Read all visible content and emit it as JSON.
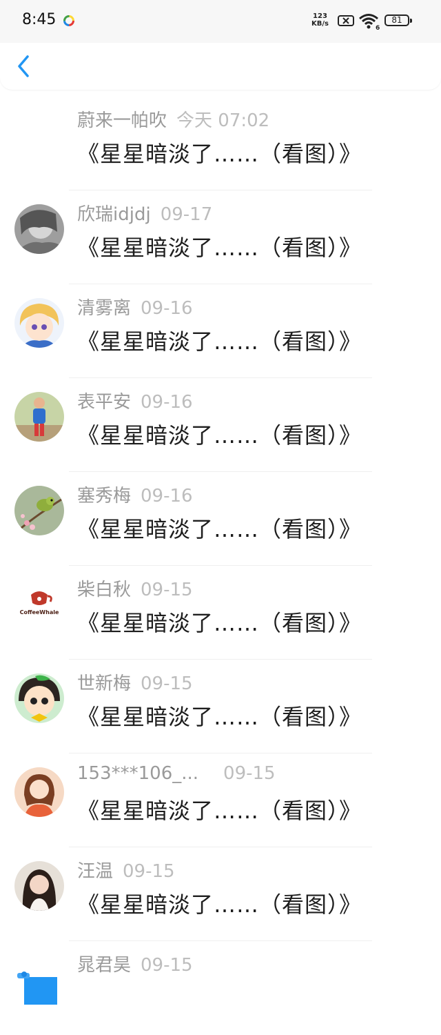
{
  "status_bar": {
    "time": "8:45",
    "net_speed_value": "123",
    "net_speed_unit": "KB/s",
    "battery": "81"
  },
  "header": {
    "back_icon": "chevron-left"
  },
  "colors": {
    "accent": "#2196f3",
    "name": "#9a9a9a",
    "date": "#bdbdbd",
    "content": "#1e1e1e"
  },
  "comments": [
    {
      "name": "蔚来一帕吹",
      "date": "今天 07:02",
      "text": "《星星暗淡了……（看图）》",
      "avatar": "none"
    },
    {
      "name": "欣瑞idjdj",
      "date": "09-17",
      "text": "《星星暗淡了……（看图）》",
      "avatar": "gray-photo"
    },
    {
      "name": "清雾离",
      "date": "09-16",
      "text": "《星星暗淡了……（看图）》",
      "avatar": "cartoon-girl"
    },
    {
      "name": "表平安",
      "date": "09-16",
      "text": "《星星暗淡了……（看图）》",
      "avatar": "kid-photo"
    },
    {
      "name": "塞秀梅",
      "date": "09-16",
      "text": "《星星暗淡了……（看图）》",
      "avatar": "bird-photo"
    },
    {
      "name": "柴白秋",
      "date": "09-15",
      "text": "《星星暗淡了……（看图）》",
      "avatar": "coffeewhale-logo",
      "logo_text": "CoffeeWhale"
    },
    {
      "name": "世新梅",
      "date": "09-15",
      "text": "《星星暗淡了……（看图）》",
      "avatar": "cartoon-face"
    },
    {
      "name": "153***106_...",
      "date": "09-15",
      "text": "《星星暗淡了……（看图）》",
      "avatar": "illustration-girl"
    },
    {
      "name": "汪温",
      "date": "09-15",
      "text": "《星星暗淡了……（看图）》",
      "avatar": "girl-photo"
    },
    {
      "name": "晁君昊",
      "date": "09-15",
      "text": "",
      "avatar": "gift-icon"
    }
  ]
}
